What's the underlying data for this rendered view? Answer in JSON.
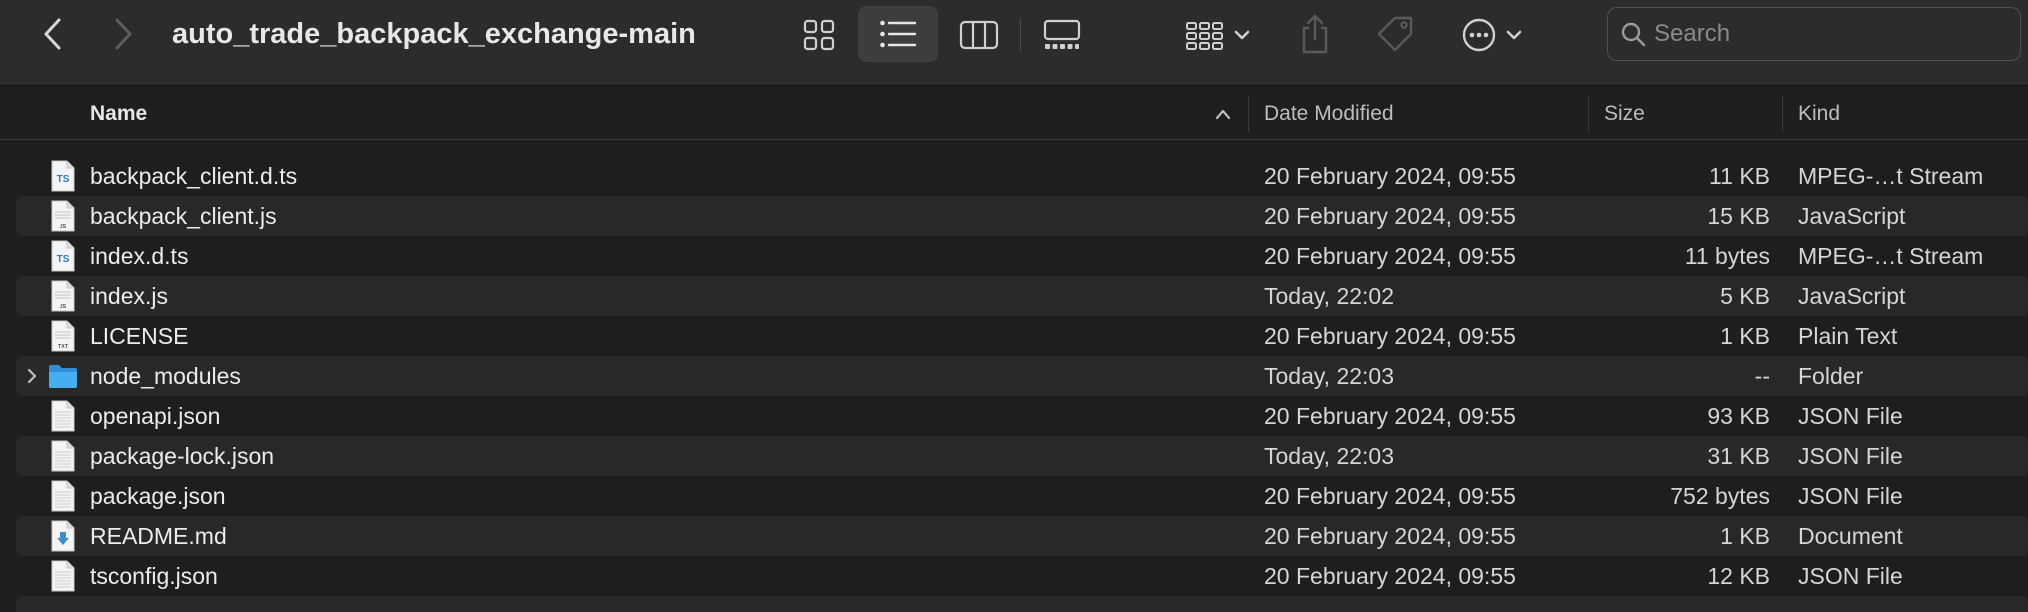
{
  "window": {
    "title": "auto_trade_backpack_exchange-main"
  },
  "toolbar": {
    "back_icon": "chevron-left-icon",
    "forward_icon": "chevron-right-icon",
    "view_modes": [
      "icons",
      "list",
      "columns",
      "gallery"
    ],
    "selected_view": "list",
    "group_icon": "group-by-icon",
    "share_icon": "share-icon",
    "tags_icon": "tag-icon",
    "more_icon": "ellipsis-circle-icon"
  },
  "search": {
    "placeholder": "Search",
    "value": ""
  },
  "columns": {
    "name": "Name",
    "date": "Date Modified",
    "size": "Size",
    "kind": "Kind"
  },
  "sort": {
    "column": "Name",
    "direction": "ascending"
  },
  "files": [
    {
      "name": "backpack_client.d.ts",
      "date": "20 February 2024, 09:55",
      "size": "11 KB",
      "kind": "MPEG-…t Stream",
      "icon": "ts-file-icon",
      "badge": "TS"
    },
    {
      "name": "backpack_client.js",
      "date": "20 February 2024, 09:55",
      "size": "15 KB",
      "kind": "JavaScript",
      "icon": "js-file-icon",
      "badge": "JS"
    },
    {
      "name": "index.d.ts",
      "date": "20 February 2024, 09:55",
      "size": "11 bytes",
      "kind": "MPEG-…t Stream",
      "icon": "ts-file-icon",
      "badge": "TS"
    },
    {
      "name": "index.js",
      "date": "Today, 22:02",
      "size": "5 KB",
      "kind": "JavaScript",
      "icon": "js-file-icon",
      "badge": "JS"
    },
    {
      "name": "LICENSE",
      "date": "20 February 2024, 09:55",
      "size": "1 KB",
      "kind": "Plain Text",
      "icon": "txt-file-icon",
      "badge": "TXT"
    },
    {
      "name": "node_modules",
      "date": "Today, 22:03",
      "size": "--",
      "kind": "Folder",
      "icon": "folder-icon",
      "badge": ""
    },
    {
      "name": "openapi.json",
      "date": "20 February 2024, 09:55",
      "size": "93 KB",
      "kind": "JSON File",
      "icon": "json-file-icon",
      "badge": ""
    },
    {
      "name": "package-lock.json",
      "date": "Today, 22:03",
      "size": "31 KB",
      "kind": "JSON File",
      "icon": "json-file-icon",
      "badge": ""
    },
    {
      "name": "package.json",
      "date": "20 February 2024, 09:55",
      "size": "752 bytes",
      "kind": "JSON File",
      "icon": "json-file-icon",
      "badge": ""
    },
    {
      "name": "README.md",
      "date": "20 February 2024, 09:55",
      "size": "1 KB",
      "kind": "Document",
      "icon": "markdown-file-icon",
      "badge": ""
    },
    {
      "name": "tsconfig.json",
      "date": "20 February 2024, 09:55",
      "size": "12 KB",
      "kind": "JSON File",
      "icon": "json-file-icon",
      "badge": ""
    }
  ],
  "colors": {
    "window_bg": "#1e1e1e",
    "toolbar_bg": "#2c2c2c",
    "alt_row_bg": "#282828",
    "folder_blue": "#3fa0e6",
    "ts_badge": "#3178c6"
  }
}
